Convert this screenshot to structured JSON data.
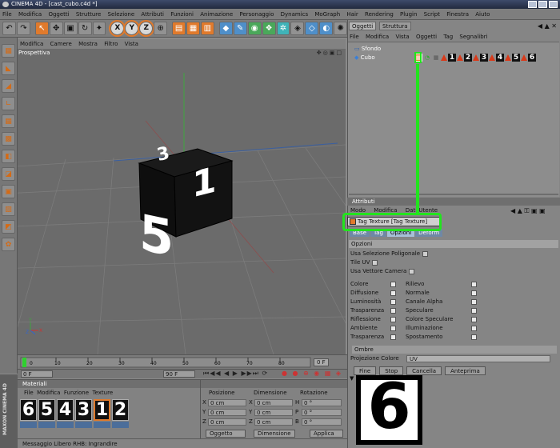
{
  "window": {
    "title": "CINEMA 4D - [cast_cubo.c4d *]"
  },
  "menubar": [
    "File",
    "Modifica",
    "Oggetti",
    "Strutture",
    "Selezione",
    "Attributi",
    "Funzioni",
    "Animazione",
    "Personaggio",
    "Dynamics",
    "MoGraph",
    "Hair",
    "Rendering",
    "Plugin",
    "Script",
    "Finestra",
    "Aiuto"
  ],
  "viewport": {
    "menu": [
      "Modifica",
      "Camere",
      "Mostra",
      "Filtro",
      "Vista"
    ],
    "label": "Prospettiva",
    "cube_digits": [
      "5",
      "3",
      "1"
    ]
  },
  "timeline": {
    "ticks": [
      "0",
      "10",
      "20",
      "30",
      "40",
      "50",
      "60",
      "70",
      "80",
      "90"
    ],
    "frame_start": "0 F",
    "frame_end": "90 F",
    "current_frame": "0 F"
  },
  "materials": {
    "menu": [
      "File",
      "Modifica",
      "Funzione",
      "Texture"
    ],
    "tiles": [
      "6",
      "5",
      "4",
      "3",
      "1",
      "2"
    ]
  },
  "coordinates": {
    "headers": [
      "Posizione",
      "Dimensione",
      "Rotazione"
    ],
    "rows": [
      {
        "a_label": "X",
        "a_val": "0 cm",
        "b_label": "X",
        "b_val": "0 cm",
        "c_label": "H",
        "c_val": "0 °"
      },
      {
        "a_label": "Y",
        "a_val": "0 cm",
        "b_label": "Y",
        "b_val": "0 cm",
        "c_label": "P",
        "c_val": "0 °"
      },
      {
        "a_label": "Z",
        "a_val": "0 cm",
        "b_label": "Z",
        "b_val": "0 cm",
        "c_label": "B",
        "c_val": "0 °"
      }
    ],
    "dropdown_object": "Oggetto",
    "dropdown_dimension": "Dimensione",
    "apply_label": "Applica"
  },
  "status": {
    "text": "Messaggio Libero RHB: Ingrandire"
  },
  "maxon_label": "MAXON CINEMA 4D",
  "object_manager": {
    "tabs": [
      "Oggetti",
      "Struttura"
    ],
    "menu": [
      "File",
      "Modifica",
      "Vista",
      "Oggetti",
      "Tag",
      "Segnalibri"
    ],
    "objects": [
      "Sfondo",
      "Cubo"
    ],
    "tag_numbers": [
      "1",
      "2",
      "3",
      "4",
      "5",
      "6"
    ]
  },
  "attribute_manager": {
    "header": "Attributi",
    "menu": [
      "Modo",
      "Modifica",
      "Dati Utente"
    ],
    "title": "Tag Texture [Tag Texture]",
    "subtabs": [
      "Base",
      "Tag",
      "Opzioni",
      "Deform"
    ],
    "active_subtab": "Opzioni",
    "section_title": "Opzioni",
    "options": [
      {
        "label": "Usa Selezione Poligonale",
        "checked": false
      },
      {
        "label": "Tile UV",
        "checked": false
      },
      {
        "label": "Usa Vettore Camera",
        "checked": false
      }
    ],
    "left_checks": [
      "Colore",
      "Diffusione",
      "Luminosità",
      "Trasparenza",
      "Riflessione",
      "Ambiente",
      "Trasparenza"
    ],
    "right_checks": [
      "Rilievo",
      "Normale",
      "Canale Alpha",
      "Speculare",
      "Colore Speculare",
      "Illuminazione",
      "Spostamento"
    ],
    "section2_title": "Ombre",
    "dropdown_label": "Projezione Colore",
    "dropdown_value": "UV",
    "buttons": [
      "Fine",
      "Stop",
      "Cancella",
      "Anteprima"
    ],
    "preview_digit": "6"
  },
  "colors": {
    "accent_orange": "#e07a2c",
    "highlight_green": "#22e41e",
    "viewport_bg": "#6b6b6b"
  }
}
